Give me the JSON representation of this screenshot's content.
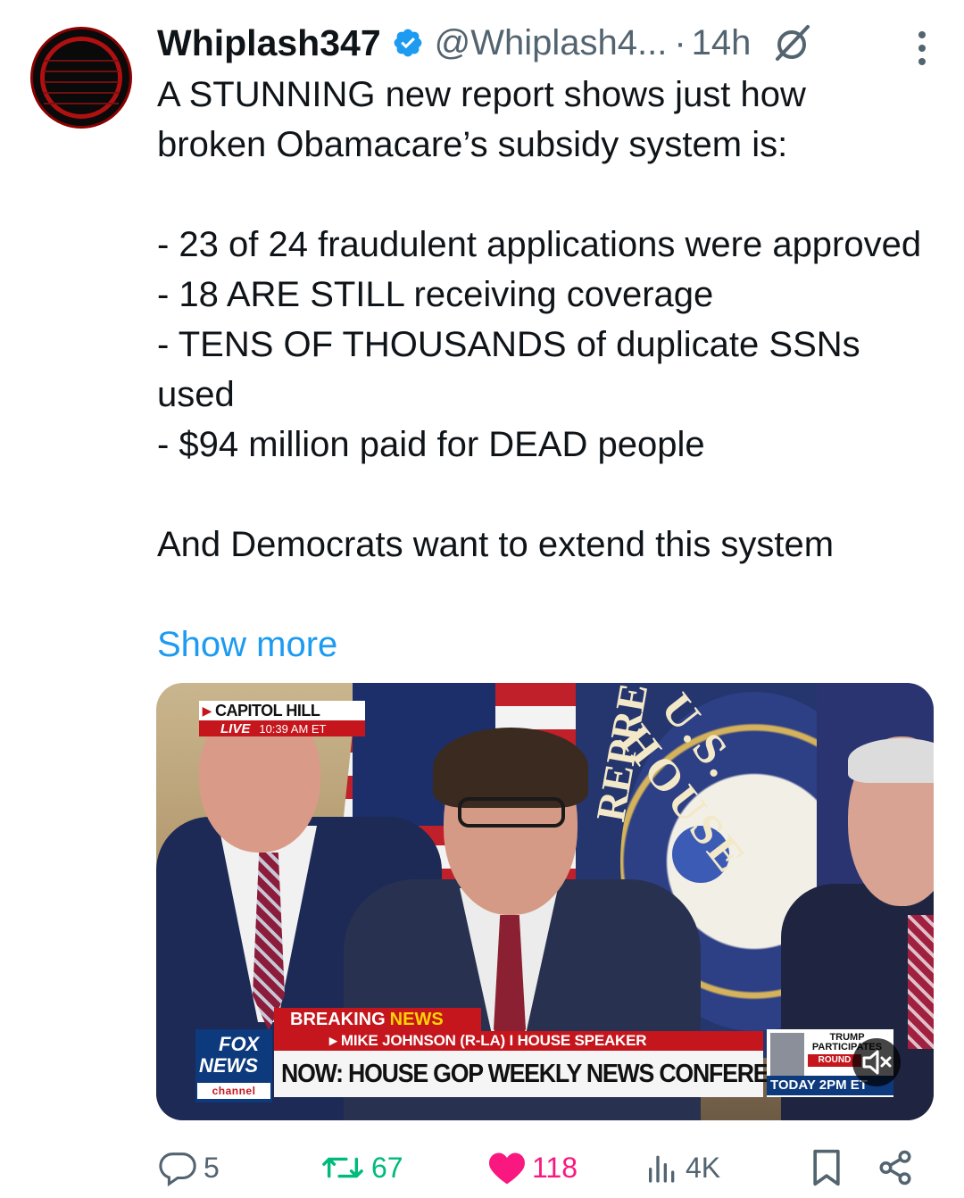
{
  "post": {
    "author_name": "Whiplash347",
    "author_handle": "@Whiplash4...",
    "separator": "·",
    "timestamp": "14h",
    "text_lines": [
      "A STUNNING new report shows just how broken Obamacare’s subsidy system is:",
      "",
      "- 23 of 24 fraudulent applications were approved",
      "- 18 ARE STILL receiving coverage",
      "- TENS OF THOUSANDS of duplicate SSNs used",
      "- $94 million paid for DEAD people",
      "",
      "And Democrats want to extend this system"
    ],
    "show_more": "Show more"
  },
  "media": {
    "live_location": "CAPITOL HILL",
    "live_label": "LIVE",
    "live_time": "10:39 AM ET",
    "breaking_1": "BREAKING",
    "breaking_2": "NEWS",
    "speaker_line": "▸ MIKE JOHNSON (R-LA) I HOUSE SPEAKER",
    "headline": "NOW: HOUSE GOP WEEKLY NEWS CONFERENCE",
    "network_1": "FOX",
    "network_2": "NEWS",
    "network_3": "channel",
    "promo_1": "TRUMP PARTICIPATES",
    "promo_2": "ROUND",
    "promo_3": "TODAY 2PM ET",
    "seal_text_1": "U.S. HOUSE",
    "seal_text_2": "REPRE"
  },
  "actions": {
    "replies": "5",
    "reposts": "67",
    "likes": "118",
    "views": "4K"
  },
  "colors": {
    "text": "#0f1419",
    "secondary": "#536471",
    "link": "#1d9bf0",
    "verified": "#1d9bf0",
    "repost": "#00ba7c",
    "like": "#f91880"
  }
}
